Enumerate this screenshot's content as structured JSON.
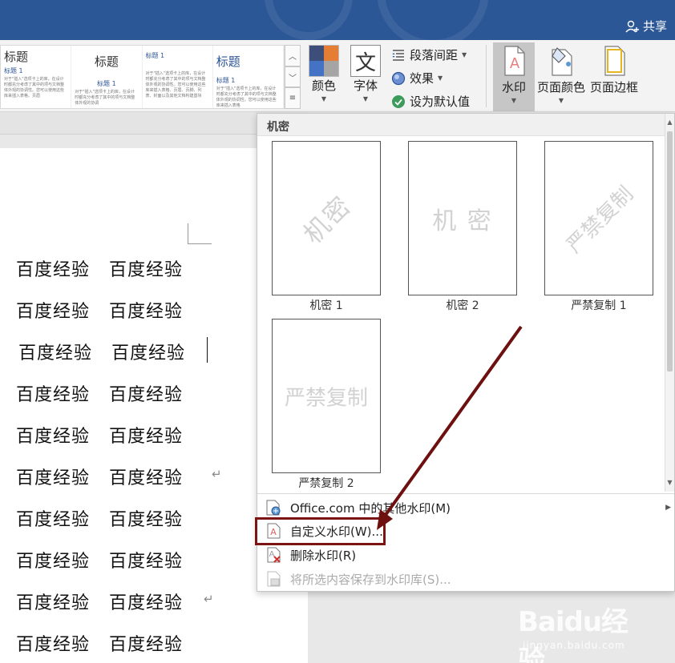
{
  "titlebar": {
    "share_label": "共享"
  },
  "ribbon": {
    "styles_gallery": [
      {
        "title": "标题",
        "subtitle": "标题 1",
        "body": "对于\"插入\"选项卡上的库，在设计时都充分考虑了其中的项与文档整体外观的协调性。您可以使用这些库来插入表格、页眉"
      },
      {
        "title": "标题",
        "subtitle": "标题 1",
        "body": "对于\"插入\"选项卡上的库，在设计时都充分考虑了其中的项与文档整体外观的协调"
      },
      {
        "title": "标题 1",
        "subtitle": "",
        "body": "对于\"插入\"选项卡上的库，在设计时都充分考虑了其中的项与文档整体外观的协调性。您可以使用这些库来插入表格、页眉、页脚、列表、封面以及其他文档构建基块"
      },
      {
        "title": "标题",
        "subtitle": "标题 1",
        "body": "对于\"插入\"选项卡上的库，在设计时都充分考虑了其中的项与文档整体外观的协调性。您可以使用这些库来插入表格"
      }
    ],
    "colors_label": "颜色",
    "fonts_label": "字体",
    "paragraph_spacing_label": "段落间距",
    "effects_label": "效果",
    "set_default_label": "设为默认值",
    "watermark_label": "水印",
    "page_color_label": "页面颜色",
    "page_border_label": "页面边框",
    "theme_colors": [
      "#3e4e7a",
      "#e57d34",
      "#4472c4",
      "#a5a5a5"
    ]
  },
  "document": {
    "lines": [
      [
        "百度经验",
        "百度经验"
      ],
      [
        "百度经验",
        "百度经验"
      ],
      [
        "百度经验",
        "百度经验"
      ],
      [
        "百度经验",
        "百度经验"
      ],
      [
        "百度经验",
        "百度经验"
      ],
      [
        "百度经验",
        "百度经验"
      ],
      [
        "百度经验",
        "百度经验"
      ],
      [
        "百度经验",
        "百度经验"
      ],
      [
        "百度经验",
        "百度经验"
      ],
      [
        "百度经验",
        "百度经验"
      ]
    ],
    "paragraph_mark": "↵"
  },
  "watermark_menu": {
    "section_title": "机密",
    "thumbnails": [
      {
        "text": "机密",
        "label": "机密 1"
      },
      {
        "text": "机 密",
        "label": "机密 2"
      },
      {
        "text": "严禁复制",
        "label": "严禁复制 1"
      },
      {
        "text": "严禁复制",
        "label": "严禁复制 2"
      }
    ],
    "more_watermarks": "Office.com 中的其他水印(M)",
    "custom_watermark": "自定义水印(W)...",
    "remove_watermark": "删除水印(R)",
    "save_selection": "将所选内容保存到水印库(S)..."
  },
  "overlay": {
    "baidu_logo": "Baidu经验",
    "baidu_url": "jingyan.baidu.com",
    "highlight_color": "#7c1414"
  }
}
